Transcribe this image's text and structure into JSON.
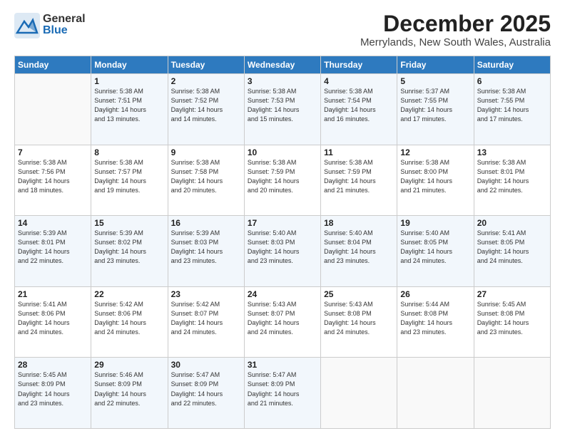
{
  "header": {
    "logo_general": "General",
    "logo_blue": "Blue",
    "month": "December 2025",
    "location": "Merrylands, New South Wales, Australia"
  },
  "days_of_week": [
    "Sunday",
    "Monday",
    "Tuesday",
    "Wednesday",
    "Thursday",
    "Friday",
    "Saturday"
  ],
  "weeks": [
    [
      {
        "num": "",
        "info": ""
      },
      {
        "num": "1",
        "info": "Sunrise: 5:38 AM\nSunset: 7:51 PM\nDaylight: 14 hours\nand 13 minutes."
      },
      {
        "num": "2",
        "info": "Sunrise: 5:38 AM\nSunset: 7:52 PM\nDaylight: 14 hours\nand 14 minutes."
      },
      {
        "num": "3",
        "info": "Sunrise: 5:38 AM\nSunset: 7:53 PM\nDaylight: 14 hours\nand 15 minutes."
      },
      {
        "num": "4",
        "info": "Sunrise: 5:38 AM\nSunset: 7:54 PM\nDaylight: 14 hours\nand 16 minutes."
      },
      {
        "num": "5",
        "info": "Sunrise: 5:37 AM\nSunset: 7:55 PM\nDaylight: 14 hours\nand 17 minutes."
      },
      {
        "num": "6",
        "info": "Sunrise: 5:38 AM\nSunset: 7:55 PM\nDaylight: 14 hours\nand 17 minutes."
      }
    ],
    [
      {
        "num": "7",
        "info": "Sunrise: 5:38 AM\nSunset: 7:56 PM\nDaylight: 14 hours\nand 18 minutes."
      },
      {
        "num": "8",
        "info": "Sunrise: 5:38 AM\nSunset: 7:57 PM\nDaylight: 14 hours\nand 19 minutes."
      },
      {
        "num": "9",
        "info": "Sunrise: 5:38 AM\nSunset: 7:58 PM\nDaylight: 14 hours\nand 20 minutes."
      },
      {
        "num": "10",
        "info": "Sunrise: 5:38 AM\nSunset: 7:59 PM\nDaylight: 14 hours\nand 20 minutes."
      },
      {
        "num": "11",
        "info": "Sunrise: 5:38 AM\nSunset: 7:59 PM\nDaylight: 14 hours\nand 21 minutes."
      },
      {
        "num": "12",
        "info": "Sunrise: 5:38 AM\nSunset: 8:00 PM\nDaylight: 14 hours\nand 21 minutes."
      },
      {
        "num": "13",
        "info": "Sunrise: 5:38 AM\nSunset: 8:01 PM\nDaylight: 14 hours\nand 22 minutes."
      }
    ],
    [
      {
        "num": "14",
        "info": "Sunrise: 5:39 AM\nSunset: 8:01 PM\nDaylight: 14 hours\nand 22 minutes."
      },
      {
        "num": "15",
        "info": "Sunrise: 5:39 AM\nSunset: 8:02 PM\nDaylight: 14 hours\nand 23 minutes."
      },
      {
        "num": "16",
        "info": "Sunrise: 5:39 AM\nSunset: 8:03 PM\nDaylight: 14 hours\nand 23 minutes."
      },
      {
        "num": "17",
        "info": "Sunrise: 5:40 AM\nSunset: 8:03 PM\nDaylight: 14 hours\nand 23 minutes."
      },
      {
        "num": "18",
        "info": "Sunrise: 5:40 AM\nSunset: 8:04 PM\nDaylight: 14 hours\nand 23 minutes."
      },
      {
        "num": "19",
        "info": "Sunrise: 5:40 AM\nSunset: 8:05 PM\nDaylight: 14 hours\nand 24 minutes."
      },
      {
        "num": "20",
        "info": "Sunrise: 5:41 AM\nSunset: 8:05 PM\nDaylight: 14 hours\nand 24 minutes."
      }
    ],
    [
      {
        "num": "21",
        "info": "Sunrise: 5:41 AM\nSunset: 8:06 PM\nDaylight: 14 hours\nand 24 minutes."
      },
      {
        "num": "22",
        "info": "Sunrise: 5:42 AM\nSunset: 8:06 PM\nDaylight: 14 hours\nand 24 minutes."
      },
      {
        "num": "23",
        "info": "Sunrise: 5:42 AM\nSunset: 8:07 PM\nDaylight: 14 hours\nand 24 minutes."
      },
      {
        "num": "24",
        "info": "Sunrise: 5:43 AM\nSunset: 8:07 PM\nDaylight: 14 hours\nand 24 minutes."
      },
      {
        "num": "25",
        "info": "Sunrise: 5:43 AM\nSunset: 8:08 PM\nDaylight: 14 hours\nand 24 minutes."
      },
      {
        "num": "26",
        "info": "Sunrise: 5:44 AM\nSunset: 8:08 PM\nDaylight: 14 hours\nand 23 minutes."
      },
      {
        "num": "27",
        "info": "Sunrise: 5:45 AM\nSunset: 8:08 PM\nDaylight: 14 hours\nand 23 minutes."
      }
    ],
    [
      {
        "num": "28",
        "info": "Sunrise: 5:45 AM\nSunset: 8:09 PM\nDaylight: 14 hours\nand 23 minutes."
      },
      {
        "num": "29",
        "info": "Sunrise: 5:46 AM\nSunset: 8:09 PM\nDaylight: 14 hours\nand 22 minutes."
      },
      {
        "num": "30",
        "info": "Sunrise: 5:47 AM\nSunset: 8:09 PM\nDaylight: 14 hours\nand 22 minutes."
      },
      {
        "num": "31",
        "info": "Sunrise: 5:47 AM\nSunset: 8:09 PM\nDaylight: 14 hours\nand 21 minutes."
      },
      {
        "num": "",
        "info": ""
      },
      {
        "num": "",
        "info": ""
      },
      {
        "num": "",
        "info": ""
      }
    ]
  ]
}
